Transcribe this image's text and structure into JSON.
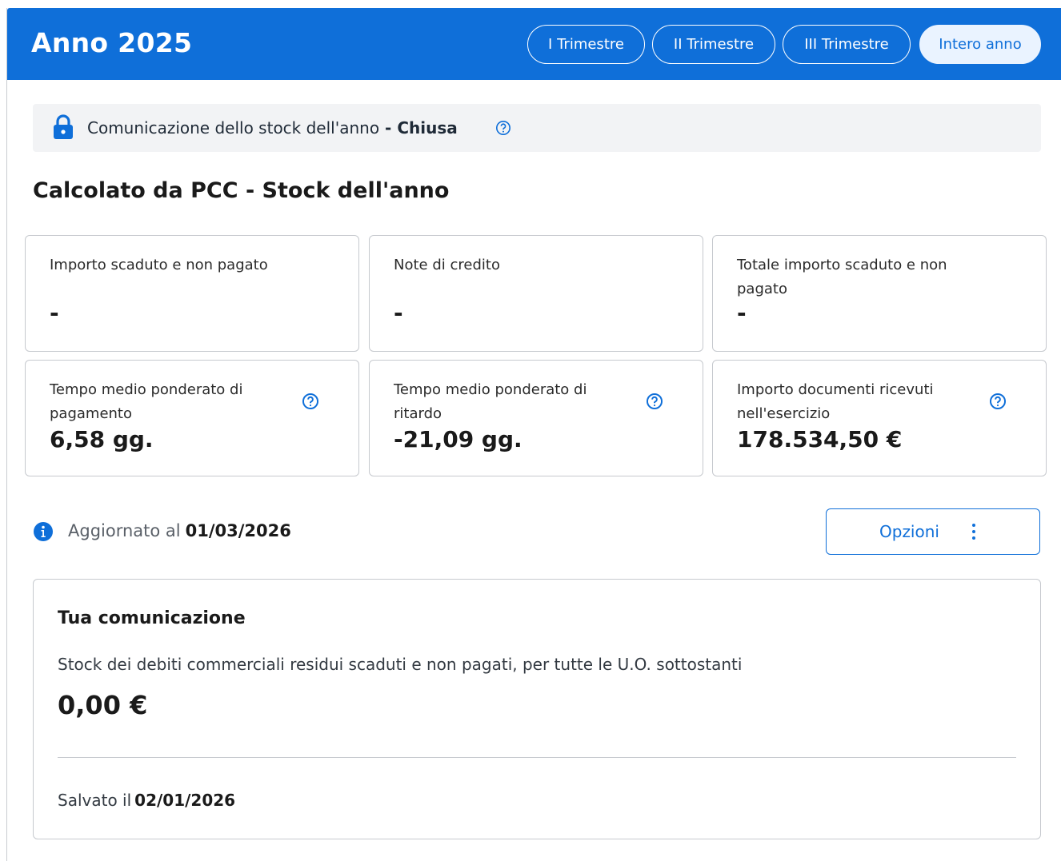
{
  "header": {
    "title": "Anno 2025",
    "tabs": [
      {
        "label": "I Trimestre",
        "active": false
      },
      {
        "label": "II Trimestre",
        "active": false
      },
      {
        "label": "III Trimestre",
        "active": false
      },
      {
        "label": "Intero anno",
        "active": true
      }
    ]
  },
  "notice": {
    "text": "Comunicazione dello stock dell'anno",
    "separator": " - ",
    "status": "Chiusa",
    "icon": "lock-icon"
  },
  "section": {
    "title": "Calcolato da PCC - Stock dell'anno"
  },
  "cards": [
    {
      "label": "Importo scaduto e non pagato",
      "value": "-",
      "help": false
    },
    {
      "label": "Note di credito",
      "value": "-",
      "help": false
    },
    {
      "label": "Totale importo scaduto e non pagato",
      "value": "-",
      "help": false
    },
    {
      "label": "Tempo medio ponderato di pagamento",
      "value": "6,58 gg.",
      "help": true
    },
    {
      "label": "Tempo medio ponderato di ritardo",
      "value": "-21,09 gg.",
      "help": true
    },
    {
      "label": "Importo documenti ricevuti nell'esercizio",
      "value": "178.534,50 €",
      "help": true
    }
  ],
  "updated": {
    "label": "Aggiornato al",
    "date": "01/03/2026"
  },
  "options_button": {
    "label": "Opzioni",
    "icon": "kebab-menu-icon"
  },
  "communication": {
    "title": "Tua comunicazione",
    "description": "Stock dei debiti commerciali residui scaduti e non pagati, per tutte le U.O. sottostanti",
    "value": "0,00 €",
    "saved_label": "Salvato il",
    "saved_date": "02/01/2026"
  },
  "colors": {
    "primary": "#0f6fd9",
    "header_bg": "#0f6fd9",
    "notice_bg": "#f2f3f5",
    "active_tab_bg": "#eaf3ff",
    "border": "#c6c9ce"
  }
}
